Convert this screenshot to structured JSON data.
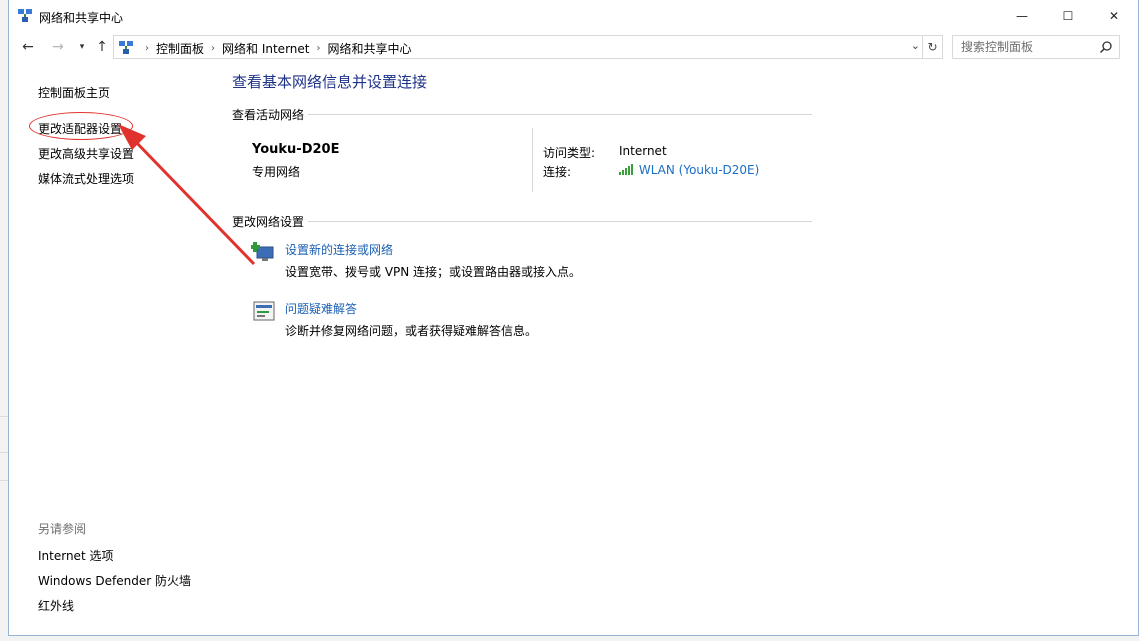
{
  "window": {
    "title": "网络和共享中心",
    "controls": {
      "minimize": "—",
      "maximize": "☐",
      "close": "✕"
    }
  },
  "address_bar": {
    "breadcrumbs": [
      "控制面板",
      "网络和 Internet",
      "网络和共享中心"
    ],
    "search_placeholder": "搜索控制面板"
  },
  "sidebar": {
    "links": [
      "控制面板主页",
      "更改适配器设置",
      "更改高级共享设置",
      "媒体流式处理选项"
    ],
    "see_also_title": "另请参阅",
    "see_also_links": [
      "Internet 选项",
      "Windows Defender 防火墙",
      "红外线"
    ]
  },
  "main": {
    "heading": "查看基本网络信息并设置连接",
    "active_networks_title": "查看活动网络",
    "network_name": "Youku-D20E",
    "network_type": "专用网络",
    "access_type_label": "访问类型:",
    "access_type_value": "Internet",
    "connection_label": "连接:",
    "connection_value": "WLAN (Youku-D20E)",
    "change_settings_title": "更改网络设置",
    "tasks": [
      {
        "link": "设置新的连接或网络",
        "desc": "设置宽带、拨号或 VPN 连接；或设置路由器或接入点。"
      },
      {
        "link": "问题疑难解答",
        "desc": "诊断并修复网络问题，或者获得疑难解答信息。"
      }
    ]
  },
  "colors": {
    "heading": "#1e3287",
    "link": "#1a5fb4",
    "annotation": "#e0332e"
  }
}
